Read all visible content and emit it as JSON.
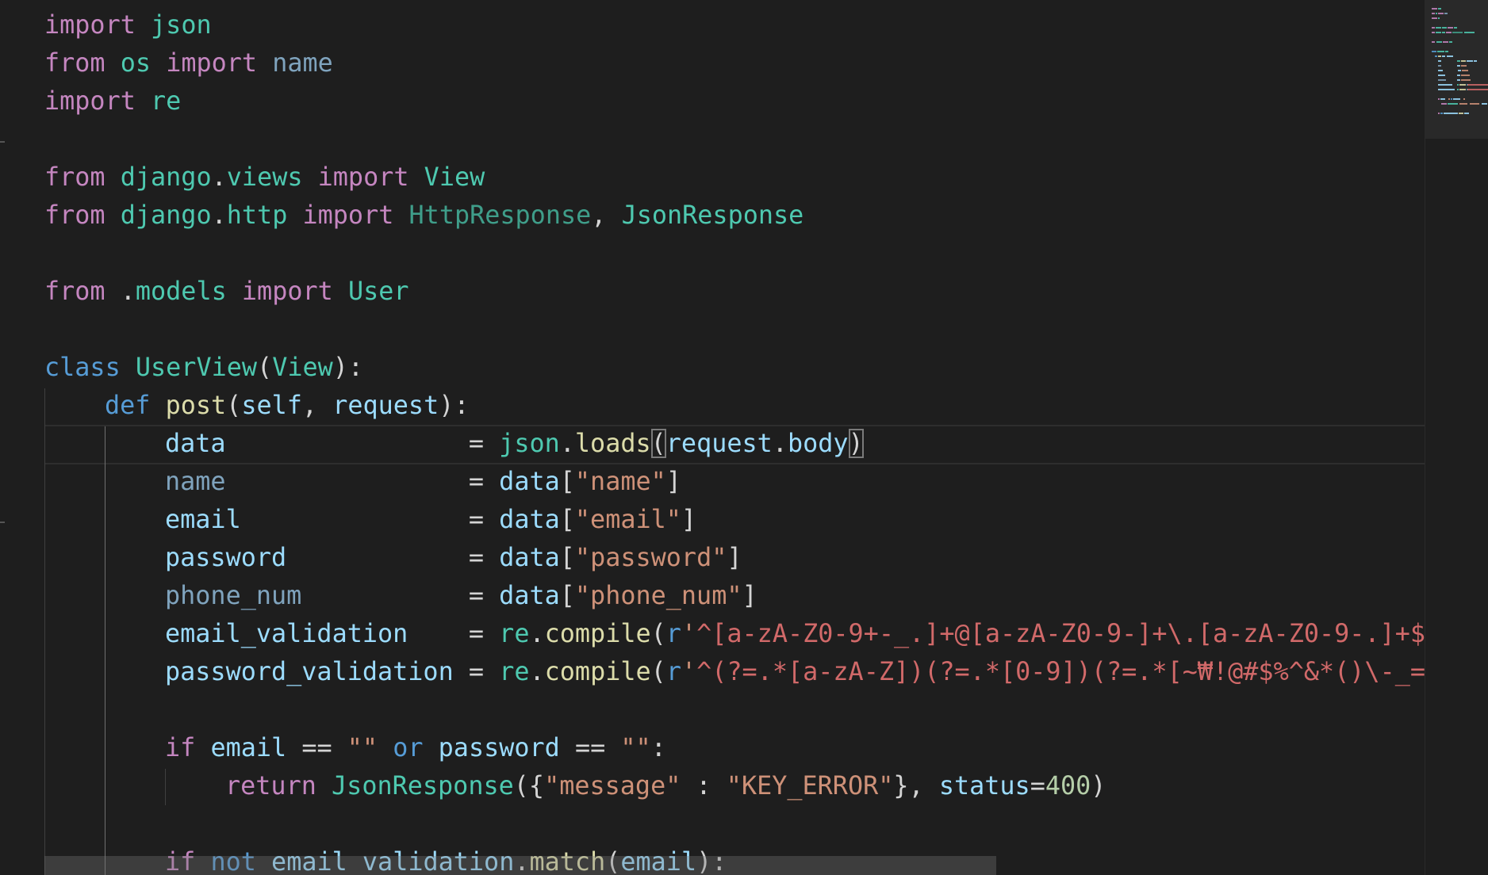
{
  "editor": {
    "language": "python",
    "colors": {
      "background": "#1e1e1e",
      "keyword": "#c586c0",
      "storage": "#569cd6",
      "module": "#4ec9b0",
      "variable": "#9cdcfe",
      "function": "#dcdcaa",
      "string": "#ce9178",
      "regex": "#d16969",
      "number": "#b5cea8"
    },
    "lines": [
      {
        "row": 0,
        "indent": 0,
        "tokens": [
          [
            "import",
            "kw-purple"
          ],
          [
            " ",
            "pun"
          ],
          [
            "json",
            "mod"
          ]
        ]
      },
      {
        "row": 1,
        "indent": 0,
        "tokens": [
          [
            "from",
            "kw-purple"
          ],
          [
            " ",
            "pun"
          ],
          [
            "os",
            "mod"
          ],
          [
            " ",
            "pun"
          ],
          [
            "import",
            "kw-purple"
          ],
          [
            " ",
            "pun"
          ],
          [
            "name",
            "var-dim"
          ]
        ]
      },
      {
        "row": 2,
        "indent": 0,
        "tokens": [
          [
            "import",
            "kw-purple"
          ],
          [
            " ",
            "pun"
          ],
          [
            "re",
            "mod"
          ]
        ]
      },
      {
        "row": 4,
        "indent": 0,
        "tokens": [
          [
            "from",
            "kw-purple"
          ],
          [
            " ",
            "pun"
          ],
          [
            "django",
            "mod"
          ],
          [
            ".",
            "pun"
          ],
          [
            "views",
            "mod"
          ],
          [
            " ",
            "pun"
          ],
          [
            "import",
            "kw-purple"
          ],
          [
            " ",
            "pun"
          ],
          [
            "View",
            "cls"
          ]
        ]
      },
      {
        "row": 5,
        "indent": 0,
        "tokens": [
          [
            "from",
            "kw-purple"
          ],
          [
            " ",
            "pun"
          ],
          [
            "django",
            "mod"
          ],
          [
            ".",
            "pun"
          ],
          [
            "http",
            "mod"
          ],
          [
            " ",
            "pun"
          ],
          [
            "import",
            "kw-purple"
          ],
          [
            " ",
            "pun"
          ],
          [
            "HttpResponse",
            "cls-dim"
          ],
          [
            ", ",
            "pun"
          ],
          [
            "JsonResponse",
            "cls"
          ]
        ]
      },
      {
        "row": 7,
        "indent": 0,
        "tokens": [
          [
            "from",
            "kw-purple"
          ],
          [
            " .",
            "pun"
          ],
          [
            "models",
            "mod"
          ],
          [
            " ",
            "pun"
          ],
          [
            "import",
            "kw-purple"
          ],
          [
            " ",
            "pun"
          ],
          [
            "User",
            "cls"
          ]
        ]
      },
      {
        "row": 9,
        "indent": 0,
        "tokens": [
          [
            "class",
            "kw-blue"
          ],
          [
            " ",
            "pun"
          ],
          [
            "UserView",
            "cls"
          ],
          [
            "(",
            "pun"
          ],
          [
            "View",
            "cls"
          ],
          [
            "):",
            "pun"
          ]
        ]
      },
      {
        "row": 10,
        "indent": 1,
        "tokens": [
          [
            "def",
            "kw-blue"
          ],
          [
            " ",
            "pun"
          ],
          [
            "post",
            "fn"
          ],
          [
            "(",
            "pun"
          ],
          [
            "self",
            "var"
          ],
          [
            ", ",
            "pun"
          ],
          [
            "request",
            "var"
          ],
          [
            "):",
            "pun"
          ]
        ]
      },
      {
        "row": 11,
        "indent": 2,
        "tokens": [
          [
            "data",
            "var"
          ],
          [
            "                ",
            "pun"
          ],
          [
            "= ",
            "pun"
          ],
          [
            "json",
            "mod"
          ],
          [
            ".",
            "pun"
          ],
          [
            "loads",
            "fn"
          ],
          [
            "(",
            "pun bracket-box"
          ],
          [
            "request",
            "var"
          ],
          [
            ".",
            "pun"
          ],
          [
            "body",
            "var"
          ],
          [
            ")",
            "pun bracket-box"
          ]
        ]
      },
      {
        "row": 12,
        "indent": 2,
        "tokens": [
          [
            "name",
            "var-dim"
          ],
          [
            "                ",
            "pun"
          ],
          [
            "= ",
            "pun"
          ],
          [
            "data",
            "var"
          ],
          [
            "[",
            "pun"
          ],
          [
            "\"name\"",
            "str"
          ],
          [
            "]",
            "pun"
          ]
        ]
      },
      {
        "row": 13,
        "indent": 2,
        "tokens": [
          [
            "email",
            "var"
          ],
          [
            "               ",
            "pun"
          ],
          [
            "= ",
            "pun"
          ],
          [
            "data",
            "var"
          ],
          [
            "[",
            "pun"
          ],
          [
            "\"email\"",
            "str"
          ],
          [
            "]",
            "pun"
          ]
        ]
      },
      {
        "row": 14,
        "indent": 2,
        "tokens": [
          [
            "password",
            "var"
          ],
          [
            "            ",
            "pun"
          ],
          [
            "= ",
            "pun"
          ],
          [
            "data",
            "var"
          ],
          [
            "[",
            "pun"
          ],
          [
            "\"password\"",
            "str"
          ],
          [
            "]",
            "pun"
          ]
        ]
      },
      {
        "row": 15,
        "indent": 2,
        "tokens": [
          [
            "phone_num",
            "var-dim"
          ],
          [
            "           ",
            "pun"
          ],
          [
            "= ",
            "pun"
          ],
          [
            "data",
            "var"
          ],
          [
            "[",
            "pun"
          ],
          [
            "\"phone_num\"",
            "str"
          ],
          [
            "]",
            "pun"
          ]
        ]
      },
      {
        "row": 16,
        "indent": 2,
        "tokens": [
          [
            "email_validation",
            "var"
          ],
          [
            "    ",
            "pun"
          ],
          [
            "= ",
            "pun"
          ],
          [
            "re",
            "mod"
          ],
          [
            ".",
            "pun"
          ],
          [
            "compile",
            "fn"
          ],
          [
            "(",
            "pun"
          ],
          [
            "r",
            "kw-blue"
          ],
          [
            "'",
            "str"
          ],
          [
            "^[a-zA-Z0-9+-_.]+@[a-zA-Z0-9-]+\\.[a-zA-Z0-9-.]+$",
            "rx"
          ]
        ]
      },
      {
        "row": 17,
        "indent": 2,
        "tokens": [
          [
            "password_validation",
            "var"
          ],
          [
            " ",
            "pun"
          ],
          [
            "= ",
            "pun"
          ],
          [
            "re",
            "mod"
          ],
          [
            ".",
            "pun"
          ],
          [
            "compile",
            "fn"
          ],
          [
            "(",
            "pun"
          ],
          [
            "r",
            "kw-blue"
          ],
          [
            "'",
            "str"
          ],
          [
            "^(?=.*[a-zA-Z])(?=.*[0-9])(?=.*[~₩!@#$%^&*()\\-_=",
            "rx"
          ]
        ]
      },
      {
        "row": 19,
        "indent": 2,
        "tokens": [
          [
            "if",
            "kw-purple"
          ],
          [
            " ",
            "pun"
          ],
          [
            "email",
            "var"
          ],
          [
            " == ",
            "pun"
          ],
          [
            "\"\"",
            "str"
          ],
          [
            " ",
            "pun"
          ],
          [
            "or",
            "kw-blue"
          ],
          [
            " ",
            "pun"
          ],
          [
            "password",
            "var"
          ],
          [
            " == ",
            "pun"
          ],
          [
            "\"\"",
            "str"
          ],
          [
            ":",
            "pun"
          ]
        ]
      },
      {
        "row": 20,
        "indent": 3,
        "tokens": [
          [
            "return",
            "kw-purple"
          ],
          [
            " ",
            "pun"
          ],
          [
            "JsonResponse",
            "cls"
          ],
          [
            "({",
            "pun"
          ],
          [
            "\"message\"",
            "str"
          ],
          [
            " : ",
            "pun"
          ],
          [
            "\"KEY_ERROR\"",
            "str"
          ],
          [
            "}, ",
            "pun"
          ],
          [
            "status",
            "var"
          ],
          [
            "=",
            "pun"
          ],
          [
            "400",
            "num"
          ],
          [
            ")",
            "pun"
          ]
        ]
      },
      {
        "row": 22,
        "indent": 2,
        "tokens": [
          [
            "if",
            "kw-purple"
          ],
          [
            " ",
            "pun"
          ],
          [
            "not",
            "kw-blue"
          ],
          [
            " ",
            "pun"
          ],
          [
            "email_validation",
            "var"
          ],
          [
            ".",
            "pun"
          ],
          [
            "match",
            "fn"
          ],
          [
            "(",
            "pun"
          ],
          [
            "email",
            "var"
          ],
          [
            "):",
            "pun"
          ]
        ]
      }
    ]
  }
}
